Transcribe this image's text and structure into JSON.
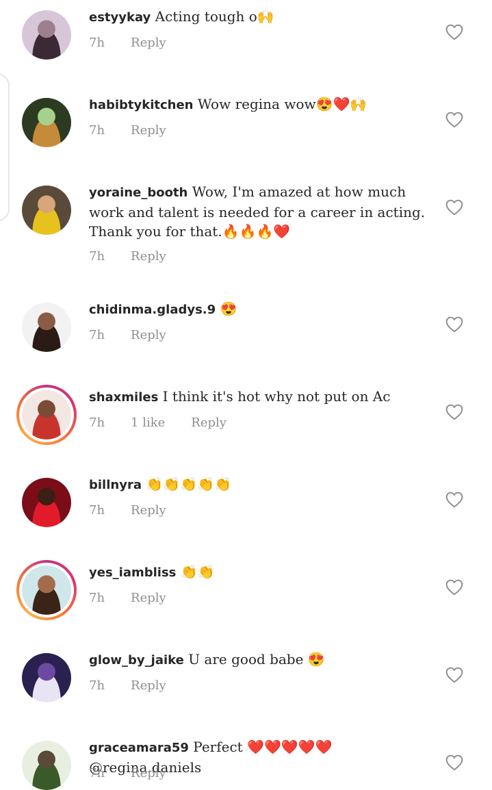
{
  "comments": [
    {
      "username": "estyykay",
      "text": "Acting tough o🙌",
      "time": "7h",
      "likes": "",
      "reply": "Reply",
      "ring": false,
      "avatar_colors": [
        "#d7c5d8",
        "#3b2a36",
        "#9e7f8f"
      ]
    },
    {
      "username": "habibtykitchen",
      "text": "Wow regina wow😍❤️🙌",
      "time": "7h",
      "likes": "",
      "reply": "Reply",
      "ring": false,
      "avatar_colors": [
        "#2c3a22",
        "#c58a3a",
        "#a6d18a"
      ]
    },
    {
      "username": "yoraine_booth",
      "text": "Wow, I'm amazed at how much work and talent is needed for a career in acting. Thank you for that.🔥🔥🔥❤️",
      "time": "7h",
      "likes": "",
      "reply": "Reply",
      "ring": false,
      "avatar_colors": [
        "#5a4a3a",
        "#e8c21c",
        "#d9a57a"
      ]
    },
    {
      "username": "chidinma.gladys.9",
      "text": "😍",
      "time": "7h",
      "likes": "",
      "reply": "Reply",
      "ring": false,
      "avatar_colors": [
        "#f2f2f2",
        "#2a1b16",
        "#8c5b45"
      ]
    },
    {
      "username": "shaxmiles",
      "text": "I think it's hot why not put on Ac",
      "time": "7h",
      "likes": "1 like",
      "reply": "Reply",
      "ring": true,
      "avatar_colors": [
        "#f3e7e4",
        "#c8342b",
        "#7a4b37"
      ]
    },
    {
      "username": "billnyra",
      "text": "👏👏👏👏👏",
      "time": "7h",
      "likes": "",
      "reply": "Reply",
      "ring": false,
      "avatar_colors": [
        "#7a0d17",
        "#e11b2a",
        "#3b1e14"
      ]
    },
    {
      "username": "yes_iambliss",
      "text": "👏👏",
      "time": "7h",
      "likes": "",
      "reply": "Reply",
      "ring": true,
      "avatar_colors": [
        "#cfe6ea",
        "#3a2418",
        "#a46c4c"
      ]
    },
    {
      "username": "glow_by_jaike",
      "text": "U are good babe 😍",
      "time": "7h",
      "likes": "",
      "reply": "Reply",
      "ring": false,
      "avatar_colors": [
        "#2a2150",
        "#e9e4f3",
        "#6d4aa2"
      ]
    },
    {
      "username": "graceamara59",
      "text": "Perfect ❤️❤️❤️❤️❤️@regina.daniels",
      "time": "7h",
      "likes": "",
      "reply": "Reply",
      "ring": false,
      "avatar_colors": [
        "#e9efe0",
        "#3a5a2a",
        "#5a4a3a"
      ]
    }
  ]
}
